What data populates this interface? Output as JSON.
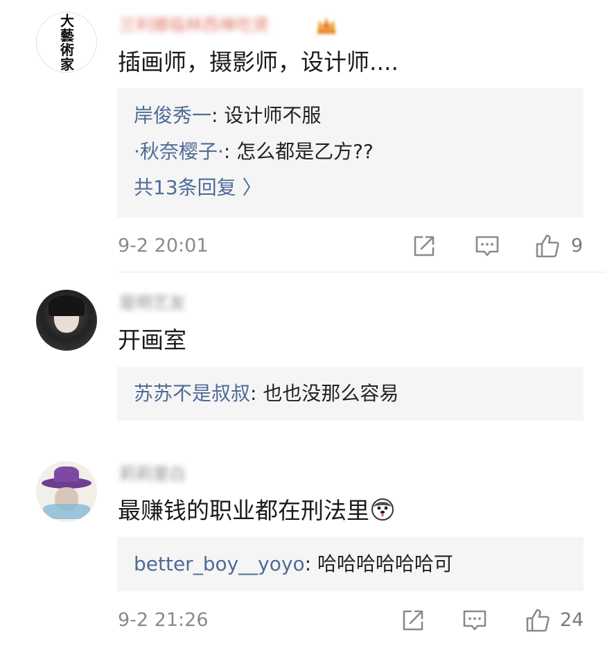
{
  "comments": [
    {
      "username": "兰利娜临林西禅吃贤",
      "text": "插画师，摄影师，设计师....",
      "avatar_text": "大藝術家",
      "replies": [
        {
          "name": "岸俊秀一",
          "sep": ": ",
          "text": "设计师不服"
        },
        {
          "name": "·秋奈樱子·",
          "sep": ": ",
          "text": "怎么都是乙方??"
        }
      ],
      "more_replies": "共13条回复 〉",
      "time": "9-2 20:01",
      "likes": "9"
    },
    {
      "username": "是明艺友",
      "text": "开画室",
      "replies": [
        {
          "name": "苏苏不是叔叔",
          "sep": ": ",
          "text": "也也没那么容易"
        }
      ]
    },
    {
      "username": "莉莉里白",
      "text": "最赚钱的职业都在刑法里",
      "replies": [
        {
          "name": "better_boy__yoyo",
          "sep": ": ",
          "text": "哈哈哈哈哈哈可"
        }
      ],
      "time": "9-2 21:26",
      "likes": "24"
    }
  ],
  "colors": {
    "link": "#4e6b96",
    "meta": "#8a8a8a",
    "reply_bg": "#f5f5f5"
  },
  "icons": [
    "share-icon",
    "comment-icon",
    "like-icon",
    "crown-badge-icon",
    "husky-emoji-icon"
  ]
}
